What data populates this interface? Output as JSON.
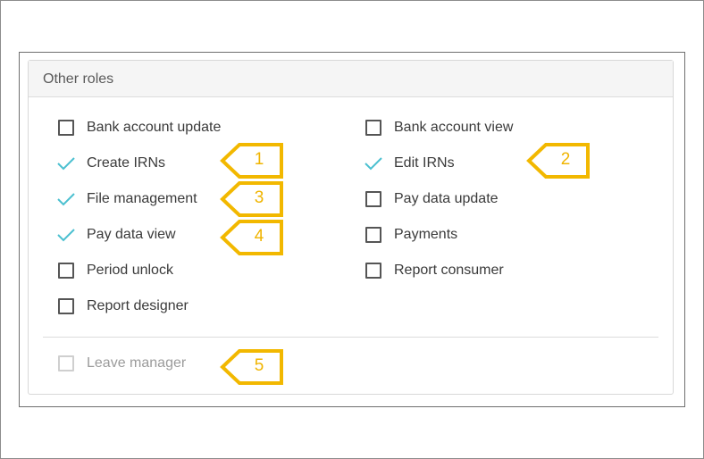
{
  "panel": {
    "title": "Other roles"
  },
  "roles_left": [
    {
      "label": "Bank account update",
      "state": "unchecked"
    },
    {
      "label": "Create IRNs",
      "state": "checked"
    },
    {
      "label": "File management",
      "state": "checked"
    },
    {
      "label": "Pay data view",
      "state": "checked"
    },
    {
      "label": "Period unlock",
      "state": "unchecked"
    },
    {
      "label": "Report designer",
      "state": "unchecked"
    }
  ],
  "roles_right": [
    {
      "label": "Bank account view",
      "state": "unchecked"
    },
    {
      "label": "Edit IRNs",
      "state": "checked"
    },
    {
      "label": "Pay data update",
      "state": "unchecked"
    },
    {
      "label": "Payments",
      "state": "unchecked"
    },
    {
      "label": "Report consumer",
      "state": "unchecked"
    }
  ],
  "disabled_role": {
    "label": "Leave manager",
    "state": "disabled"
  },
  "callouts": [
    "1",
    "2",
    "3",
    "4",
    "5"
  ],
  "colors": {
    "check": "#4bc0d0",
    "callout": "#f2b800",
    "box_border": "#555555"
  }
}
